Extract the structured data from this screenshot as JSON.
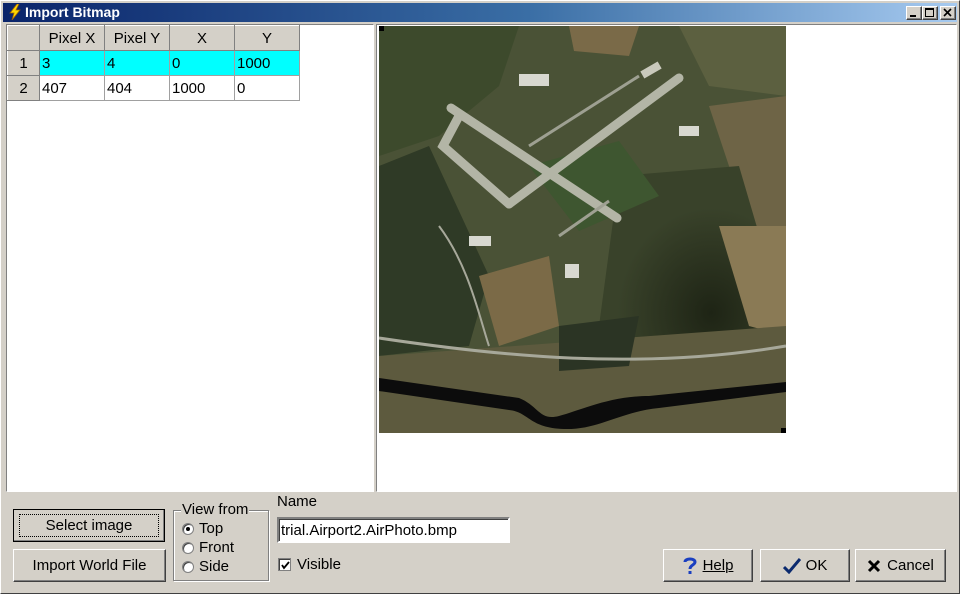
{
  "window": {
    "title": "Import Bitmap"
  },
  "grid": {
    "columns": [
      "Pixel X",
      "Pixel Y",
      "X",
      "Y"
    ],
    "rows": [
      {
        "num": "1",
        "cells": [
          "3",
          "4",
          "0",
          "1000"
        ]
      },
      {
        "num": "2",
        "cells": [
          "407",
          "404",
          "1000",
          "0"
        ]
      }
    ],
    "selected_row": 1
  },
  "buttons": {
    "select_image": "Select image",
    "import_world_file": "Import World File",
    "help": "Help",
    "ok": "OK",
    "cancel": "Cancel"
  },
  "view_from": {
    "label": "View from",
    "options": [
      "Top",
      "Front",
      "Side"
    ],
    "selected": "Top"
  },
  "name": {
    "label": "Name",
    "value": "trial.Airport2.AirPhoto.bmp"
  },
  "visible": {
    "label": "Visible",
    "checked": true
  },
  "colors": {
    "selected_row": "#00ffff",
    "titlebar_start": "#0a246a",
    "titlebar_end": "#a6caf0",
    "face": "#d4d0c8"
  },
  "icons": {
    "title": "lightning-bolt-icon",
    "help": "question-mark-icon",
    "ok": "checkmark-icon",
    "cancel": "x-mark-icon"
  }
}
